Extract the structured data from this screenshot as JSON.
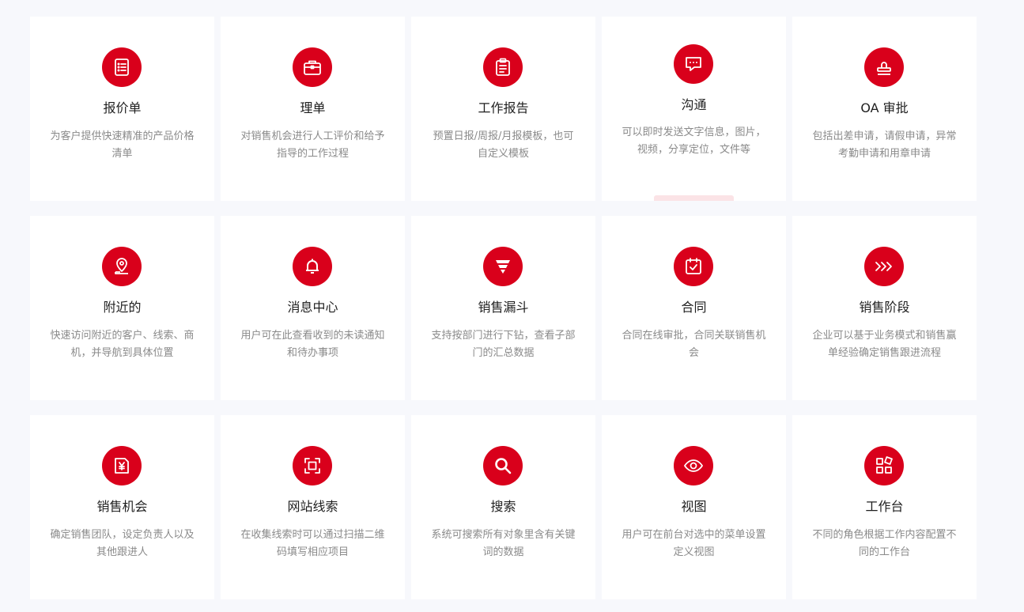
{
  "colors": {
    "accent": "#d9001b",
    "background": "#f7f8fc",
    "card": "#ffffff",
    "title": "#1f1f1f",
    "description": "#8a8a8a"
  },
  "features": [
    {
      "icon": "list-document-icon",
      "title": "报价单",
      "desc": "为客户提供快速精准的产品价格清单"
    },
    {
      "icon": "briefcase-icon",
      "title": "理单",
      "desc": "对销售机会进行人工评价和给予指导的工作过程"
    },
    {
      "icon": "clipboard-icon",
      "title": "工作报告",
      "desc": "预置日报/周报/月报模板，也可自定义模板"
    },
    {
      "icon": "chat-bubble-icon",
      "title": "沟通",
      "desc": "可以即时发送文字信息，图片，视频，分享定位，文件等"
    },
    {
      "icon": "stamp-icon",
      "title": "OA 审批",
      "desc": "包括出差申请，请假申请，异常考勤申请和用章申请"
    },
    {
      "icon": "location-pin-icon",
      "title": "附近的",
      "desc": "快速访问附近的客户、线索、商机，并导航到具体位置"
    },
    {
      "icon": "bell-icon",
      "title": "消息中心",
      "desc": "用户可在此查看收到的未读通知和待办事项"
    },
    {
      "icon": "funnel-icon",
      "title": "销售漏斗",
      "desc": "支持按部门进行下钻，查看子部门的汇总数据"
    },
    {
      "icon": "calendar-check-icon",
      "title": "合同",
      "desc": "合同在线审批，合同关联销售机会"
    },
    {
      "icon": "chevrons-right-icon",
      "title": "销售阶段",
      "desc": "企业可以基于业务模式和销售赢单经验确定销售跟进流程"
    },
    {
      "icon": "yen-document-icon",
      "title": "销售机会",
      "desc": "确定销售团队，设定负责人以及其他跟进人"
    },
    {
      "icon": "scan-frame-icon",
      "title": "网站线索",
      "desc": "在收集线索时可以通过扫描二维码填写相应项目"
    },
    {
      "icon": "search-icon",
      "title": "搜索",
      "desc": "系统可搜索所有对象里含有关键词的数据"
    },
    {
      "icon": "eye-icon",
      "title": "视图",
      "desc": "用户可在前台对选中的菜单设置定义视图"
    },
    {
      "icon": "grid-apps-icon",
      "title": "工作台",
      "desc": "不同的角色根据工作内容配置不同的工作台"
    }
  ]
}
